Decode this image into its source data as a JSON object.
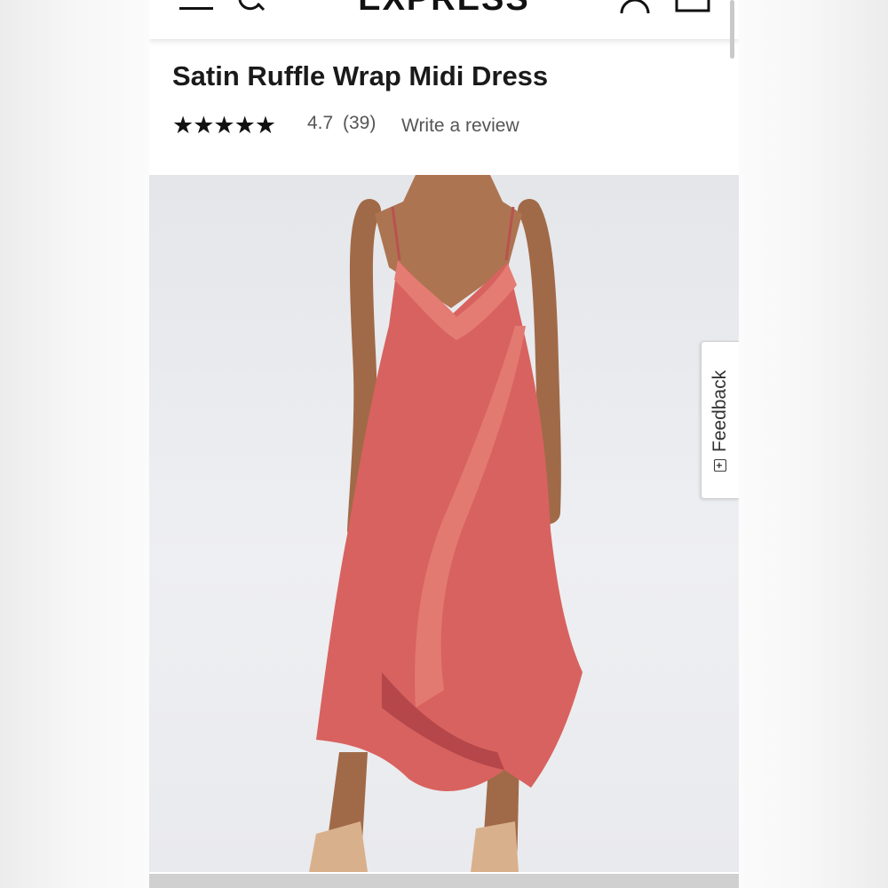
{
  "header": {
    "brand": "EXPRESS",
    "menu_icon": "hamburger-menu-icon",
    "search_icon": "search-icon",
    "account_icon": "account-icon",
    "bag_icon": "shopping-bag-icon"
  },
  "product": {
    "title": "Satin Ruffle Wrap Midi Dress",
    "stars": "★★★★★",
    "rating": "4.7",
    "review_count": "(39)",
    "write_review": "Write a review",
    "image_icon": "product-photo",
    "dress_color": "#d8625f"
  },
  "feedback": {
    "label": "Feedback",
    "icon": "plus-box-icon"
  }
}
